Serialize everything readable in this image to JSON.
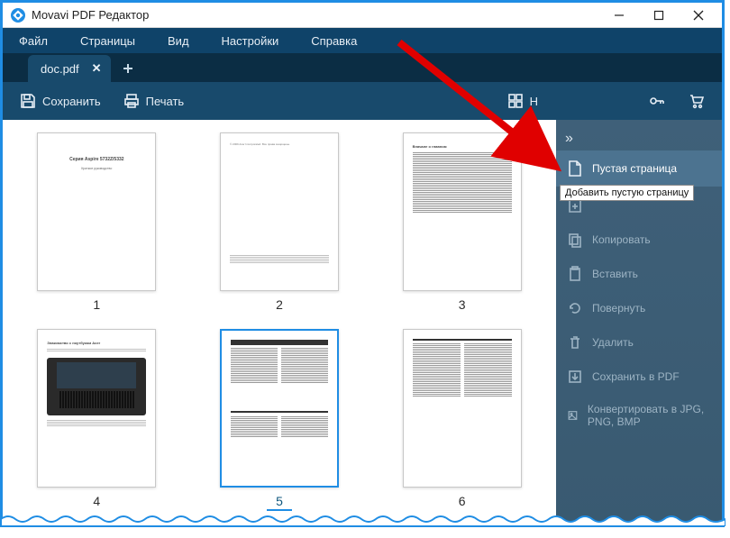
{
  "title": "Movavi PDF Редактор",
  "menu": {
    "items": [
      "Файл",
      "Страницы",
      "Вид",
      "Настройки",
      "Справка"
    ]
  },
  "tabs": {
    "current": "doc.pdf"
  },
  "toolbar": {
    "save": "Сохранить",
    "print": "Печать",
    "view": "Н"
  },
  "sidepanel": {
    "tooltip": "Добавить пустую страницу",
    "items": [
      {
        "label": "Пустая страница",
        "icon": "file-blank-icon",
        "state": "active"
      },
      {
        "label": "",
        "icon": "file-plus-icon",
        "state": "dim"
      },
      {
        "label": "Копировать",
        "icon": "copy-icon",
        "state": "dim"
      },
      {
        "label": "Вставить",
        "icon": "paste-icon",
        "state": "dim"
      },
      {
        "label": "Повернуть",
        "icon": "rotate-icon",
        "state": "dim"
      },
      {
        "label": "Удалить",
        "icon": "trash-icon",
        "state": "dim"
      },
      {
        "label": "Сохранить в PDF",
        "icon": "save-pdf-icon",
        "state": "dim"
      },
      {
        "label": "Конвертировать в JPG, PNG, BMP",
        "icon": "image-export-icon",
        "state": "dim"
      }
    ]
  },
  "thumbs": {
    "selected": 5,
    "pages": [
      {
        "n": 1,
        "title": "Серия Aspire 5732Z/5332",
        "sub": "Краткое руководство"
      },
      {
        "n": 2
      },
      {
        "n": 3,
        "heading": "Вначале о главном"
      },
      {
        "n": 4,
        "heading": "Знакомство с ноутбуком Acer"
      },
      {
        "n": 5
      },
      {
        "n": 6
      }
    ]
  },
  "colors": {
    "accent": "#1f8de4",
    "dark": "#184a6c",
    "panel": "#3f6079"
  }
}
